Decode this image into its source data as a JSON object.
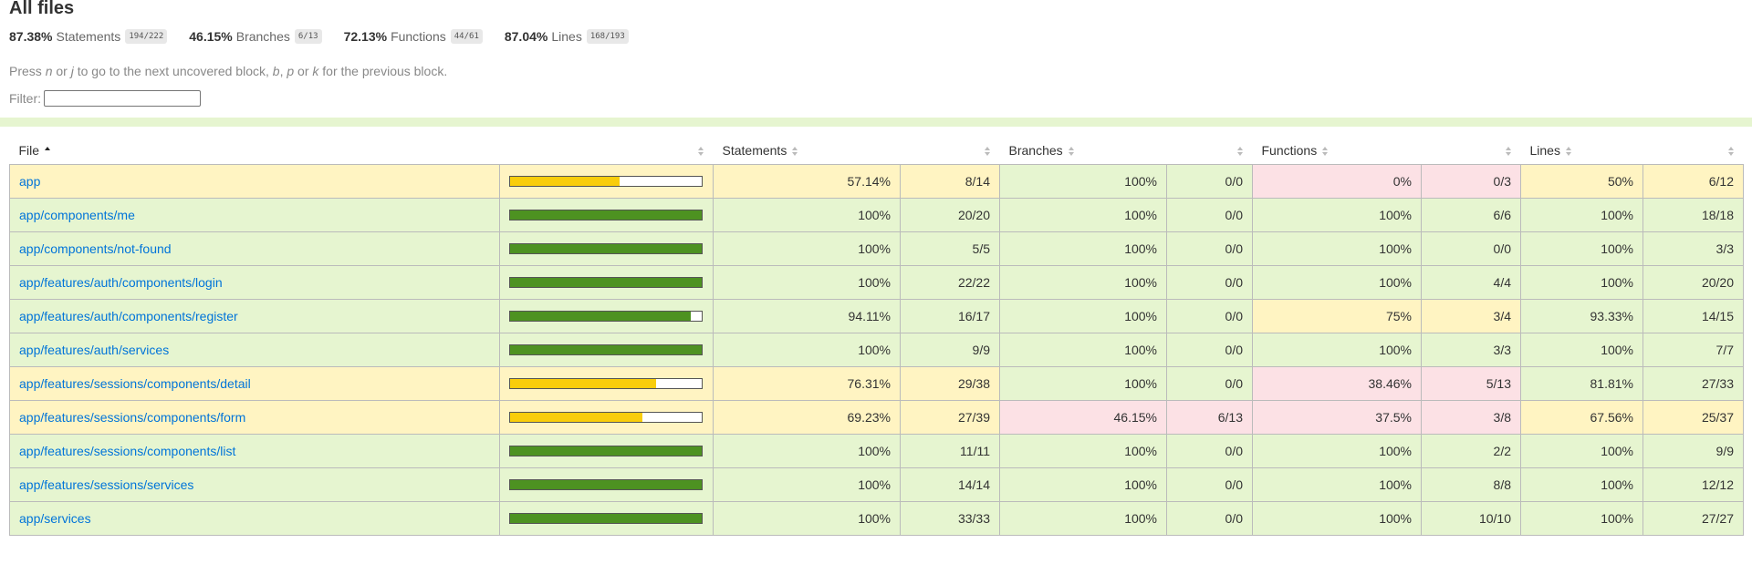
{
  "page": {
    "title": "All files",
    "summary": [
      {
        "pct": "87.38%",
        "label": "Statements",
        "fraction": "194/222"
      },
      {
        "pct": "46.15%",
        "label": "Branches",
        "fraction": "6/13"
      },
      {
        "pct": "72.13%",
        "label": "Functions",
        "fraction": "44/61"
      },
      {
        "pct": "87.04%",
        "label": "Lines",
        "fraction": "168/193"
      }
    ],
    "hint": {
      "p1": "Press ",
      "k1": "n",
      "p2": " or ",
      "k2": "j",
      "p3": " to go to the next uncovered block, ",
      "k3": "b",
      "p4": ", ",
      "k4": "p",
      "p5": " or ",
      "k5": "k",
      "p6": " for the previous block."
    },
    "filter_label": "Filter:",
    "filter_value": ""
  },
  "colors": {
    "high": "#4d9221",
    "medium": "#f9cd0b",
    "low": "#c21f39"
  },
  "table": {
    "headers": {
      "file": "File",
      "statements": "Statements",
      "branches": "Branches",
      "functions": "Functions",
      "lines": "Lines"
    },
    "rows": [
      {
        "file": "app",
        "coverage": 57.14,
        "sLevel": "medium",
        "s": "57.14%",
        "sf": "8/14",
        "bLevel": "high",
        "b": "100%",
        "bf": "0/0",
        "fLevel": "low",
        "f": "0%",
        "ff": "0/3",
        "lLevel": "medium",
        "l": "50%",
        "lf": "6/12"
      },
      {
        "file": "app/components/me",
        "coverage": 100,
        "sLevel": "high",
        "s": "100%",
        "sf": "20/20",
        "bLevel": "high",
        "b": "100%",
        "bf": "0/0",
        "fLevel": "high",
        "f": "100%",
        "ff": "6/6",
        "lLevel": "high",
        "l": "100%",
        "lf": "18/18"
      },
      {
        "file": "app/components/not-found",
        "coverage": 100,
        "sLevel": "high",
        "s": "100%",
        "sf": "5/5",
        "bLevel": "high",
        "b": "100%",
        "bf": "0/0",
        "fLevel": "high",
        "f": "100%",
        "ff": "0/0",
        "lLevel": "high",
        "l": "100%",
        "lf": "3/3"
      },
      {
        "file": "app/features/auth/components/login",
        "coverage": 100,
        "sLevel": "high",
        "s": "100%",
        "sf": "22/22",
        "bLevel": "high",
        "b": "100%",
        "bf": "0/0",
        "fLevel": "high",
        "f": "100%",
        "ff": "4/4",
        "lLevel": "high",
        "l": "100%",
        "lf": "20/20"
      },
      {
        "file": "app/features/auth/components/register",
        "coverage": 94.11,
        "sLevel": "high",
        "s": "94.11%",
        "sf": "16/17",
        "bLevel": "high",
        "b": "100%",
        "bf": "0/0",
        "fLevel": "medium",
        "f": "75%",
        "ff": "3/4",
        "lLevel": "high",
        "l": "93.33%",
        "lf": "14/15"
      },
      {
        "file": "app/features/auth/services",
        "coverage": 100,
        "sLevel": "high",
        "s": "100%",
        "sf": "9/9",
        "bLevel": "high",
        "b": "100%",
        "bf": "0/0",
        "fLevel": "high",
        "f": "100%",
        "ff": "3/3",
        "lLevel": "high",
        "l": "100%",
        "lf": "7/7"
      },
      {
        "file": "app/features/sessions/components/detail",
        "coverage": 76.31,
        "sLevel": "medium",
        "s": "76.31%",
        "sf": "29/38",
        "bLevel": "high",
        "b": "100%",
        "bf": "0/0",
        "fLevel": "low",
        "f": "38.46%",
        "ff": "5/13",
        "lLevel": "high",
        "l": "81.81%",
        "lf": "27/33"
      },
      {
        "file": "app/features/sessions/components/form",
        "coverage": 69.23,
        "sLevel": "medium",
        "s": "69.23%",
        "sf": "27/39",
        "bLevel": "low",
        "b": "46.15%",
        "bf": "6/13",
        "fLevel": "low",
        "f": "37.5%",
        "ff": "3/8",
        "lLevel": "medium",
        "l": "67.56%",
        "lf": "25/37"
      },
      {
        "file": "app/features/sessions/components/list",
        "coverage": 100,
        "sLevel": "high",
        "s": "100%",
        "sf": "11/11",
        "bLevel": "high",
        "b": "100%",
        "bf": "0/0",
        "fLevel": "high",
        "f": "100%",
        "ff": "2/2",
        "lLevel": "high",
        "l": "100%",
        "lf": "9/9"
      },
      {
        "file": "app/features/sessions/services",
        "coverage": 100,
        "sLevel": "high",
        "s": "100%",
        "sf": "14/14",
        "bLevel": "high",
        "b": "100%",
        "bf": "0/0",
        "fLevel": "high",
        "f": "100%",
        "ff": "8/8",
        "lLevel": "high",
        "l": "100%",
        "lf": "12/12"
      },
      {
        "file": "app/services",
        "coverage": 100,
        "sLevel": "high",
        "s": "100%",
        "sf": "33/33",
        "bLevel": "high",
        "b": "100%",
        "bf": "0/0",
        "fLevel": "high",
        "f": "100%",
        "ff": "10/10",
        "lLevel": "high",
        "l": "100%",
        "lf": "27/27"
      }
    ]
  }
}
